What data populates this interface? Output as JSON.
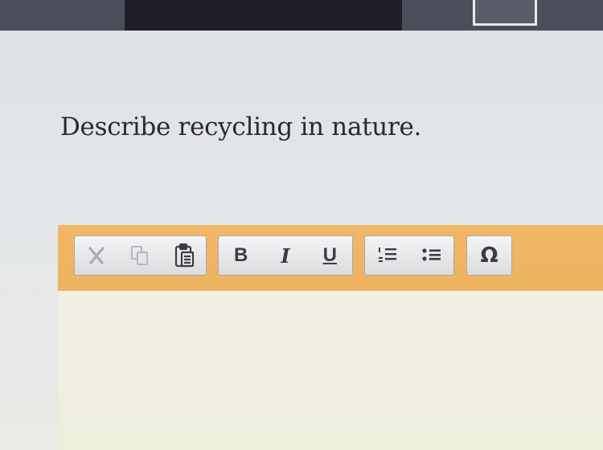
{
  "question": {
    "text": "Describe recycling in nature."
  },
  "toolbar": {
    "clipboard": [
      {
        "name": "cut",
        "icon": "scissors-icon",
        "enabled": false
      },
      {
        "name": "copy",
        "icon": "copy-icon",
        "enabled": false
      },
      {
        "name": "paste",
        "icon": "clipboard-icon",
        "enabled": true
      }
    ],
    "format": {
      "bold_label": "B",
      "italic_label": "I",
      "underline_label": "U"
    },
    "lists": [
      {
        "name": "numbered-list",
        "icon": "numbered-list-icon"
      },
      {
        "name": "bulleted-list",
        "icon": "bulleted-list-icon"
      }
    ],
    "special_char_label": "Ω"
  },
  "colors": {
    "toolbar_bg": "#eeb35f",
    "editor_bg": "#efeee5",
    "text": "#2a2a2e",
    "icon": "#3b3c44",
    "disabled_icon": "#a8aab4"
  }
}
